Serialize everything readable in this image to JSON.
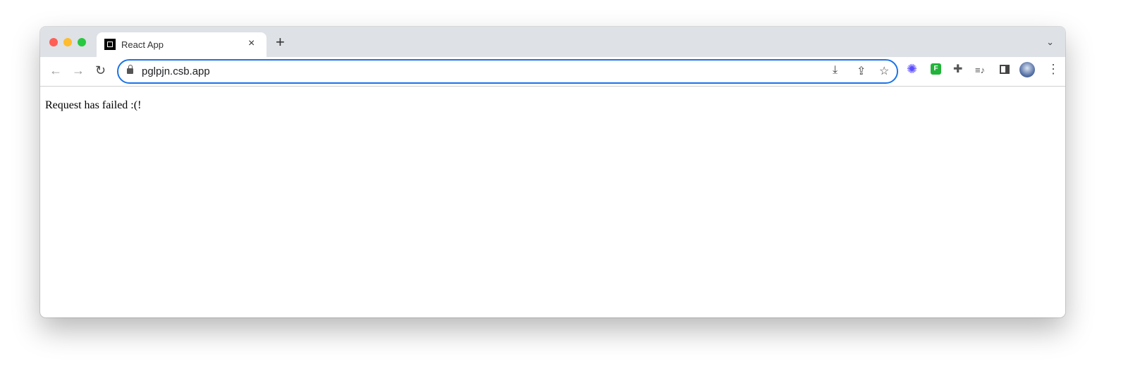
{
  "browser": {
    "tab": {
      "title": "React App",
      "favicon": "codesandbox-icon",
      "close": "×"
    },
    "new_tab": "+",
    "tab_menu": "⌄",
    "nav": {
      "back": "←",
      "forward": "→",
      "reload": "↻"
    },
    "address_bar": {
      "url": "pglpjn.csb.app"
    },
    "omnibox_icons": {
      "install": "⤓",
      "share": "⇪",
      "bookmark": "☆"
    },
    "extensions": {
      "ext1": "✺",
      "ext2": "F",
      "puzzle": "✚",
      "media": "≡♪",
      "menu": "⋮"
    },
    "accent": "#1a73e8"
  },
  "page": {
    "message": "Request has failed :(!"
  }
}
